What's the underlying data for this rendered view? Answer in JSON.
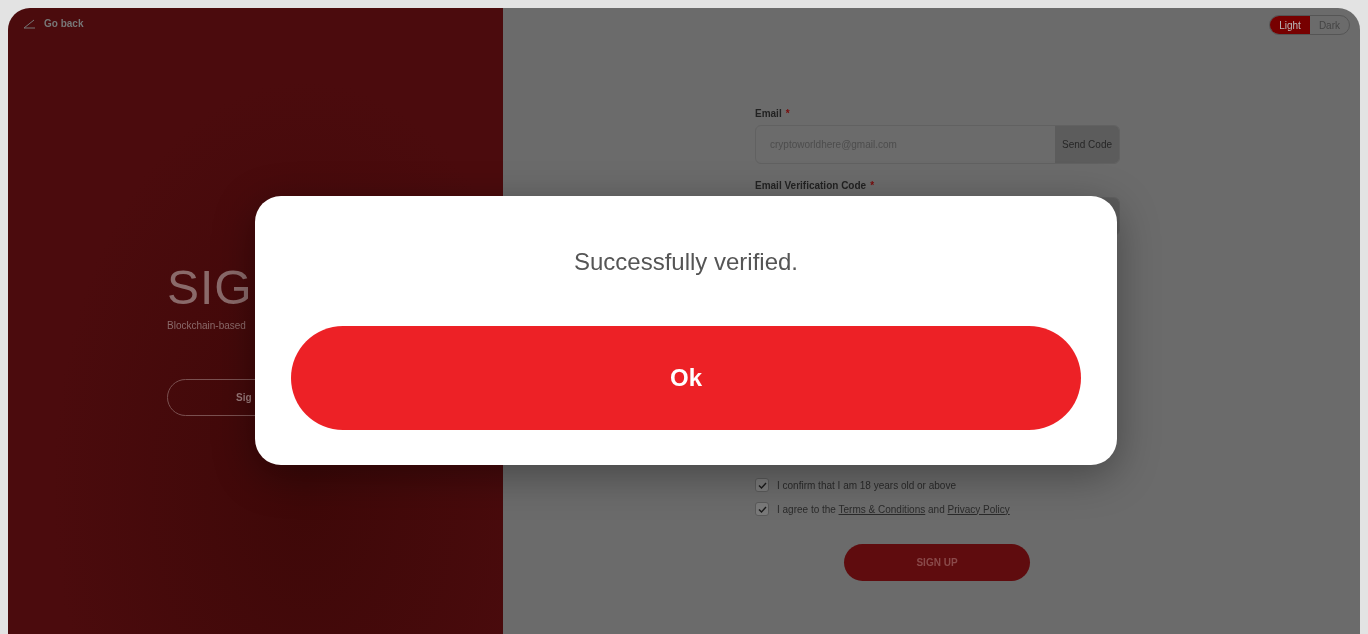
{
  "back_link": "Go back",
  "theme_toggle": [
    {
      "label": "Light",
      "selected": true
    },
    {
      "label": "Dark",
      "selected": false
    }
  ],
  "hero": {
    "title": "SIG",
    "subtitle": "Blockchain-based",
    "button": "Sig"
  },
  "form": {
    "fields": [
      {
        "label": "Email",
        "marker": "*",
        "value": "cryptoworldhere@gmail.com",
        "action": "Send Code"
      },
      {
        "label": "Email Verification Code",
        "marker": "*"
      }
    ],
    "checks": [
      {
        "checked": true,
        "parts": [
          {
            "kind": "text",
            "text": "I confirm that I am 18 years old or above"
          }
        ]
      },
      {
        "checked": true,
        "parts": [
          {
            "kind": "text",
            "text": "I agree to the"
          },
          {
            "kind": "link",
            "text": "Terms & Conditions"
          },
          {
            "kind": "text",
            "text": "and"
          },
          {
            "kind": "link",
            "text": "Privacy Policy"
          }
        ]
      }
    ],
    "submit": "SIGN UP"
  },
  "dialog": {
    "message": "Successfully verified.",
    "button": "Ok"
  }
}
